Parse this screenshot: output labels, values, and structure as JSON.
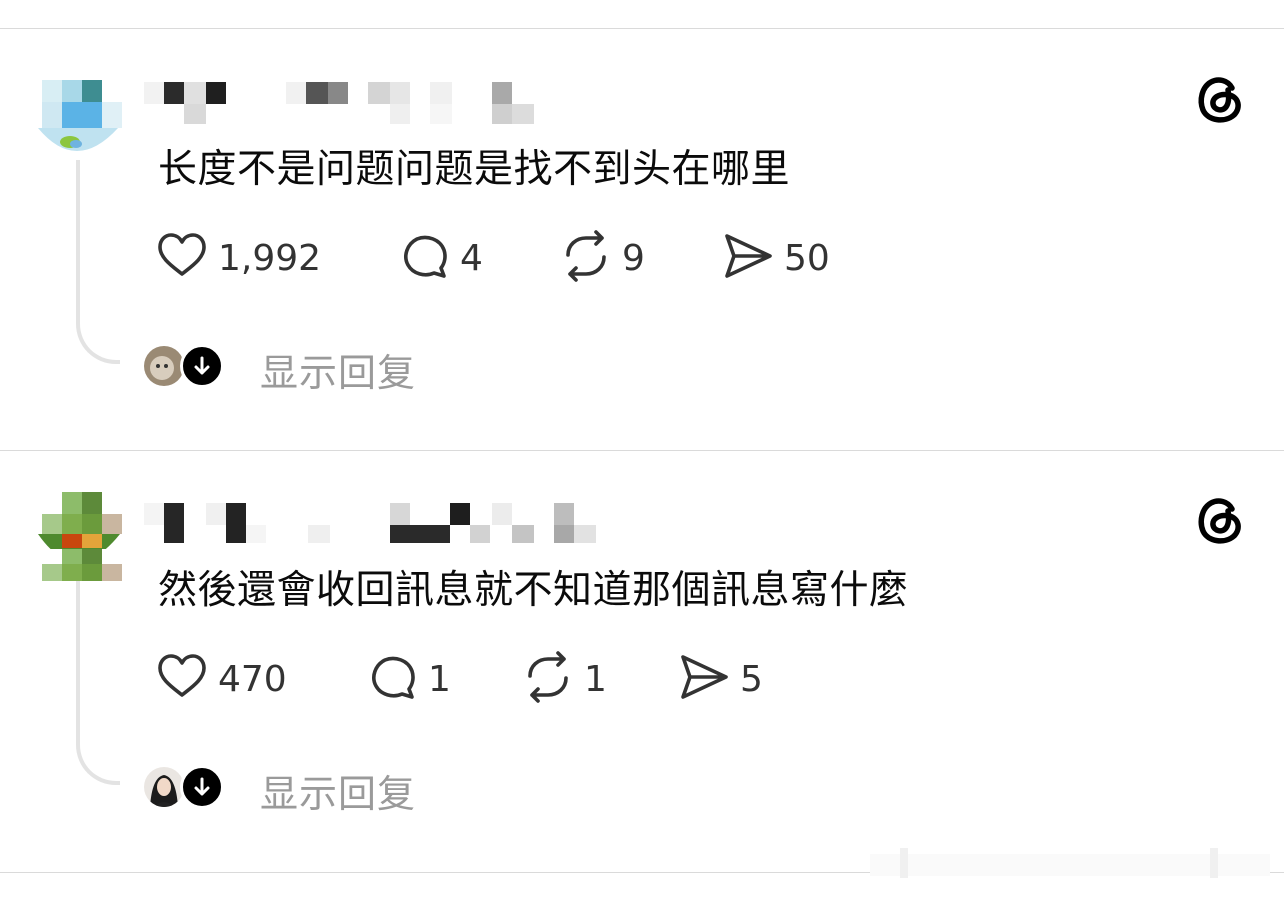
{
  "posts": [
    {
      "username_text": "",
      "text": "长度不是问题问题是找不到头在哪里",
      "likes": "1,992",
      "replies": "4",
      "reposts": "9",
      "shares": "50",
      "show_replies_label": "显示回复"
    },
    {
      "username_text": "",
      "text": "然後還會收回訊息就不知道那個訊息寫什麼",
      "likes": "470",
      "replies": "1",
      "reposts": "1",
      "shares": "5",
      "show_replies_label": "显示回复"
    }
  ],
  "icons": {
    "like": "heart-icon",
    "reply": "comment-icon",
    "repost": "repost-icon",
    "share": "send-icon",
    "brand": "threads-logo-icon",
    "expand": "arrow-down-icon"
  },
  "colors": {
    "text": "#0b0b0b",
    "muted": "#9a9a9a",
    "icon": "#333333",
    "divider": "#dadada"
  }
}
